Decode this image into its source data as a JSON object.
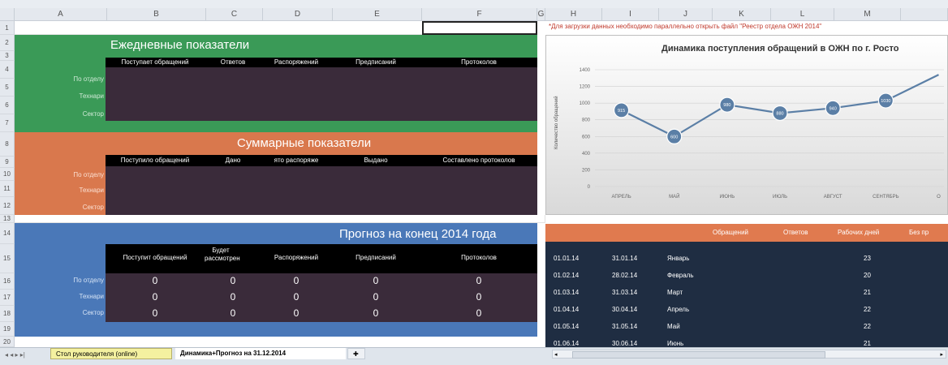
{
  "columns": [
    "A",
    "B",
    "C",
    "D",
    "E",
    "F",
    "G",
    "H",
    "I",
    "J",
    "K",
    "L",
    "M"
  ],
  "rows": [
    "1",
    "2",
    "3",
    "4",
    "5",
    "6",
    "7",
    "8",
    "9",
    "10",
    "11",
    "12",
    "13",
    "14",
    "15",
    "16",
    "17",
    "18",
    "19",
    "20"
  ],
  "note": "*Для загрузки данных необходимо параллельно открыть файл \"Реестр отдела ОЖН 2014\"",
  "daily": {
    "title": "Ежедневные показатели",
    "headers": [
      "Поступает обращений",
      "Ответов",
      "Распоряжений",
      "Предписаний",
      "Протоколов"
    ],
    "row_labels": [
      "По отделу",
      "Технари",
      "Сектор"
    ],
    "color": "#3a9a57"
  },
  "summary": {
    "title": "Суммарные показатели",
    "headers": [
      "Поступило обращений",
      "Дано",
      "ято распоряже",
      "Выдано",
      "Составлено протоколов"
    ],
    "row_labels": [
      "По отделу",
      "Технари",
      "Сектор"
    ],
    "color": "#d9784d"
  },
  "forecast": {
    "title": "Прогноз на конец 2014 года",
    "headers": [
      "Поступит обращений",
      "Будет рассмотрен",
      "Распоряжений",
      "Предписаний",
      "Протоколов"
    ],
    "row_labels": [
      "По отделу",
      "Технари",
      "Сектор"
    ],
    "values": [
      [
        "0",
        "0",
        "0",
        "0",
        "0"
      ],
      [
        "0",
        "0",
        "0",
        "0",
        "0"
      ],
      [
        "0",
        "0",
        "0",
        "0",
        "0"
      ]
    ],
    "color": "#4a78b8"
  },
  "chart_data": {
    "type": "line",
    "title": "Динамика поступления обращений в ОЖН по г. Росто",
    "ylabel": "Количество обращений",
    "categories": [
      "АПРЕЛЬ",
      "МАЙ",
      "ИЮНЬ",
      "ИЮЛЬ",
      "АВГУСТ",
      "СЕНТЯБРЬ",
      "О"
    ],
    "yticks": [
      "1400",
      "1200",
      "1000",
      "800",
      "600",
      "400",
      "200",
      "0"
    ],
    "ylim": [
      0,
      1400
    ],
    "series": [
      {
        "values": [
          915,
          600,
          980,
          880,
          940,
          1030,
          1340
        ]
      }
    ],
    "data_labels": [
      "915",
      "600",
      "980",
      "880",
      "940",
      "1030"
    ],
    "color": "#5b7fa6"
  },
  "right_table": {
    "headers": [
      "Обращений",
      "Ответов",
      "Рабочих дней",
      "Без пр"
    ],
    "rows": [
      {
        "start": "01.01.14",
        "end": "31.01.14",
        "month": "Январь",
        "days": "23"
      },
      {
        "start": "01.02.14",
        "end": "28.02.14",
        "month": "Февраль",
        "days": "20"
      },
      {
        "start": "01.03.14",
        "end": "31.03.14",
        "month": "Март",
        "days": "21"
      },
      {
        "start": "01.04.14",
        "end": "30.04.14",
        "month": "Апрель",
        "days": "22"
      },
      {
        "start": "01.05.14",
        "end": "31.05.14",
        "month": "Май",
        "days": "22"
      },
      {
        "start": "01.06.14",
        "end": "30.06.14",
        "month": "Июнь",
        "days": "21"
      }
    ]
  },
  "tabs": {
    "nav": "◂ ◂ ▸ ▸|",
    "items": [
      "Стол руководителя (online)",
      "Динамика+Прогноз на 31.12.2014"
    ],
    "active": 1
  }
}
